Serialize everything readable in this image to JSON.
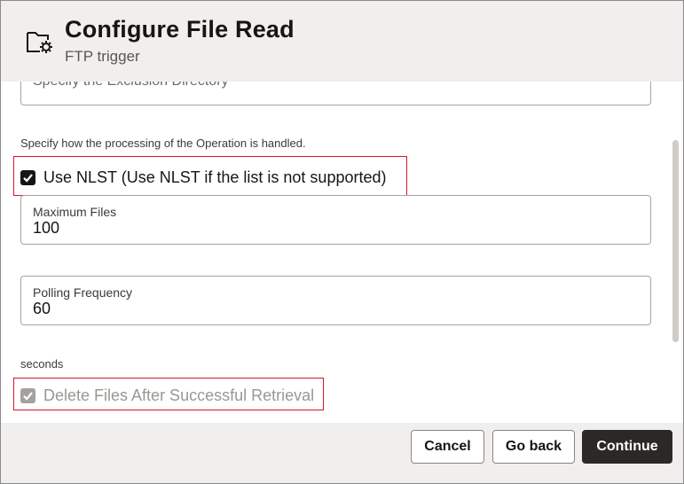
{
  "header": {
    "title": "Configure File Read",
    "subtitle": "FTP trigger",
    "icon": "folder-settings-icon"
  },
  "body": {
    "exclusion_field": {
      "value": "Specify the Exclusion Directory"
    },
    "processing_help": "Specify how the processing of the Operation is handled.",
    "use_nlst": {
      "label": "Use NLST (Use NLST if the list is not supported)",
      "checked": true
    },
    "maximum_files": {
      "label": "Maximum Files",
      "value": "100"
    },
    "polling_frequency": {
      "label": "Polling Frequency",
      "value": "60"
    },
    "polling_unit": "seconds",
    "delete_files": {
      "label": "Delete Files After Successful Retrieval",
      "checked": true,
      "disabled": true
    }
  },
  "footer": {
    "cancel_label": "Cancel",
    "go_back_label": "Go back",
    "continue_label": "Continue"
  },
  "colors": {
    "highlight": "#d4172b",
    "primary_button": "#2b2928",
    "header_bg": "#f1efed"
  }
}
